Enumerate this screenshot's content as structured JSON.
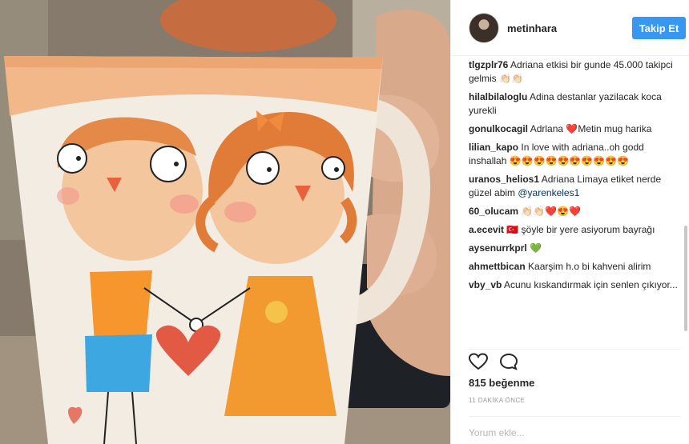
{
  "post": {
    "username": "metinhara",
    "follow_label": "Takip Et",
    "likes_text": "815 beğenme",
    "timestamp": "11 DAKİKA ÖNCE",
    "comment_placeholder": "Yorum ekle..."
  },
  "comments": [
    {
      "user": "tlgzplr76",
      "text": "Adriana etkisi bir gunde 45.000 takipci gelmis 👏🏻👏🏻"
    },
    {
      "user": "hilalbilaloglu",
      "text": "Adina destanlar yazilacak koca yurekli"
    },
    {
      "user": "gonulkocagil",
      "text": "Adrlana ❤️Metin mug harika"
    },
    {
      "user": "lilian_kapo",
      "text": "In love with adriana..oh godd inshallah 😍😍😍😍😍😍😍😍😍😍"
    },
    {
      "user": "uranos_helios1",
      "text": "Adriana Limaya etiket nerde güzel abim",
      "mention": "@yarenkeles1"
    },
    {
      "user": "60_olucam",
      "text": "👏🏻👏🏻❤️😍❤️"
    },
    {
      "user": "a.ecevit",
      "text": "🇹🇷 şöyle bir yere asiyorum bayrağı"
    },
    {
      "user": "aysenurrkprl",
      "text": "💚"
    },
    {
      "user": "ahmettbican",
      "text": "Kaarşim h.o bi kahveni alirim"
    },
    {
      "user": "vby_vb",
      "text": "Acunu kıskandırmak için senlen çıkıyor..."
    }
  ],
  "icons": {
    "like": "heart-icon",
    "comment": "comment-icon",
    "avatar": "avatar"
  },
  "colors": {
    "follow_button": "#3897f0",
    "mention": "#003569"
  }
}
